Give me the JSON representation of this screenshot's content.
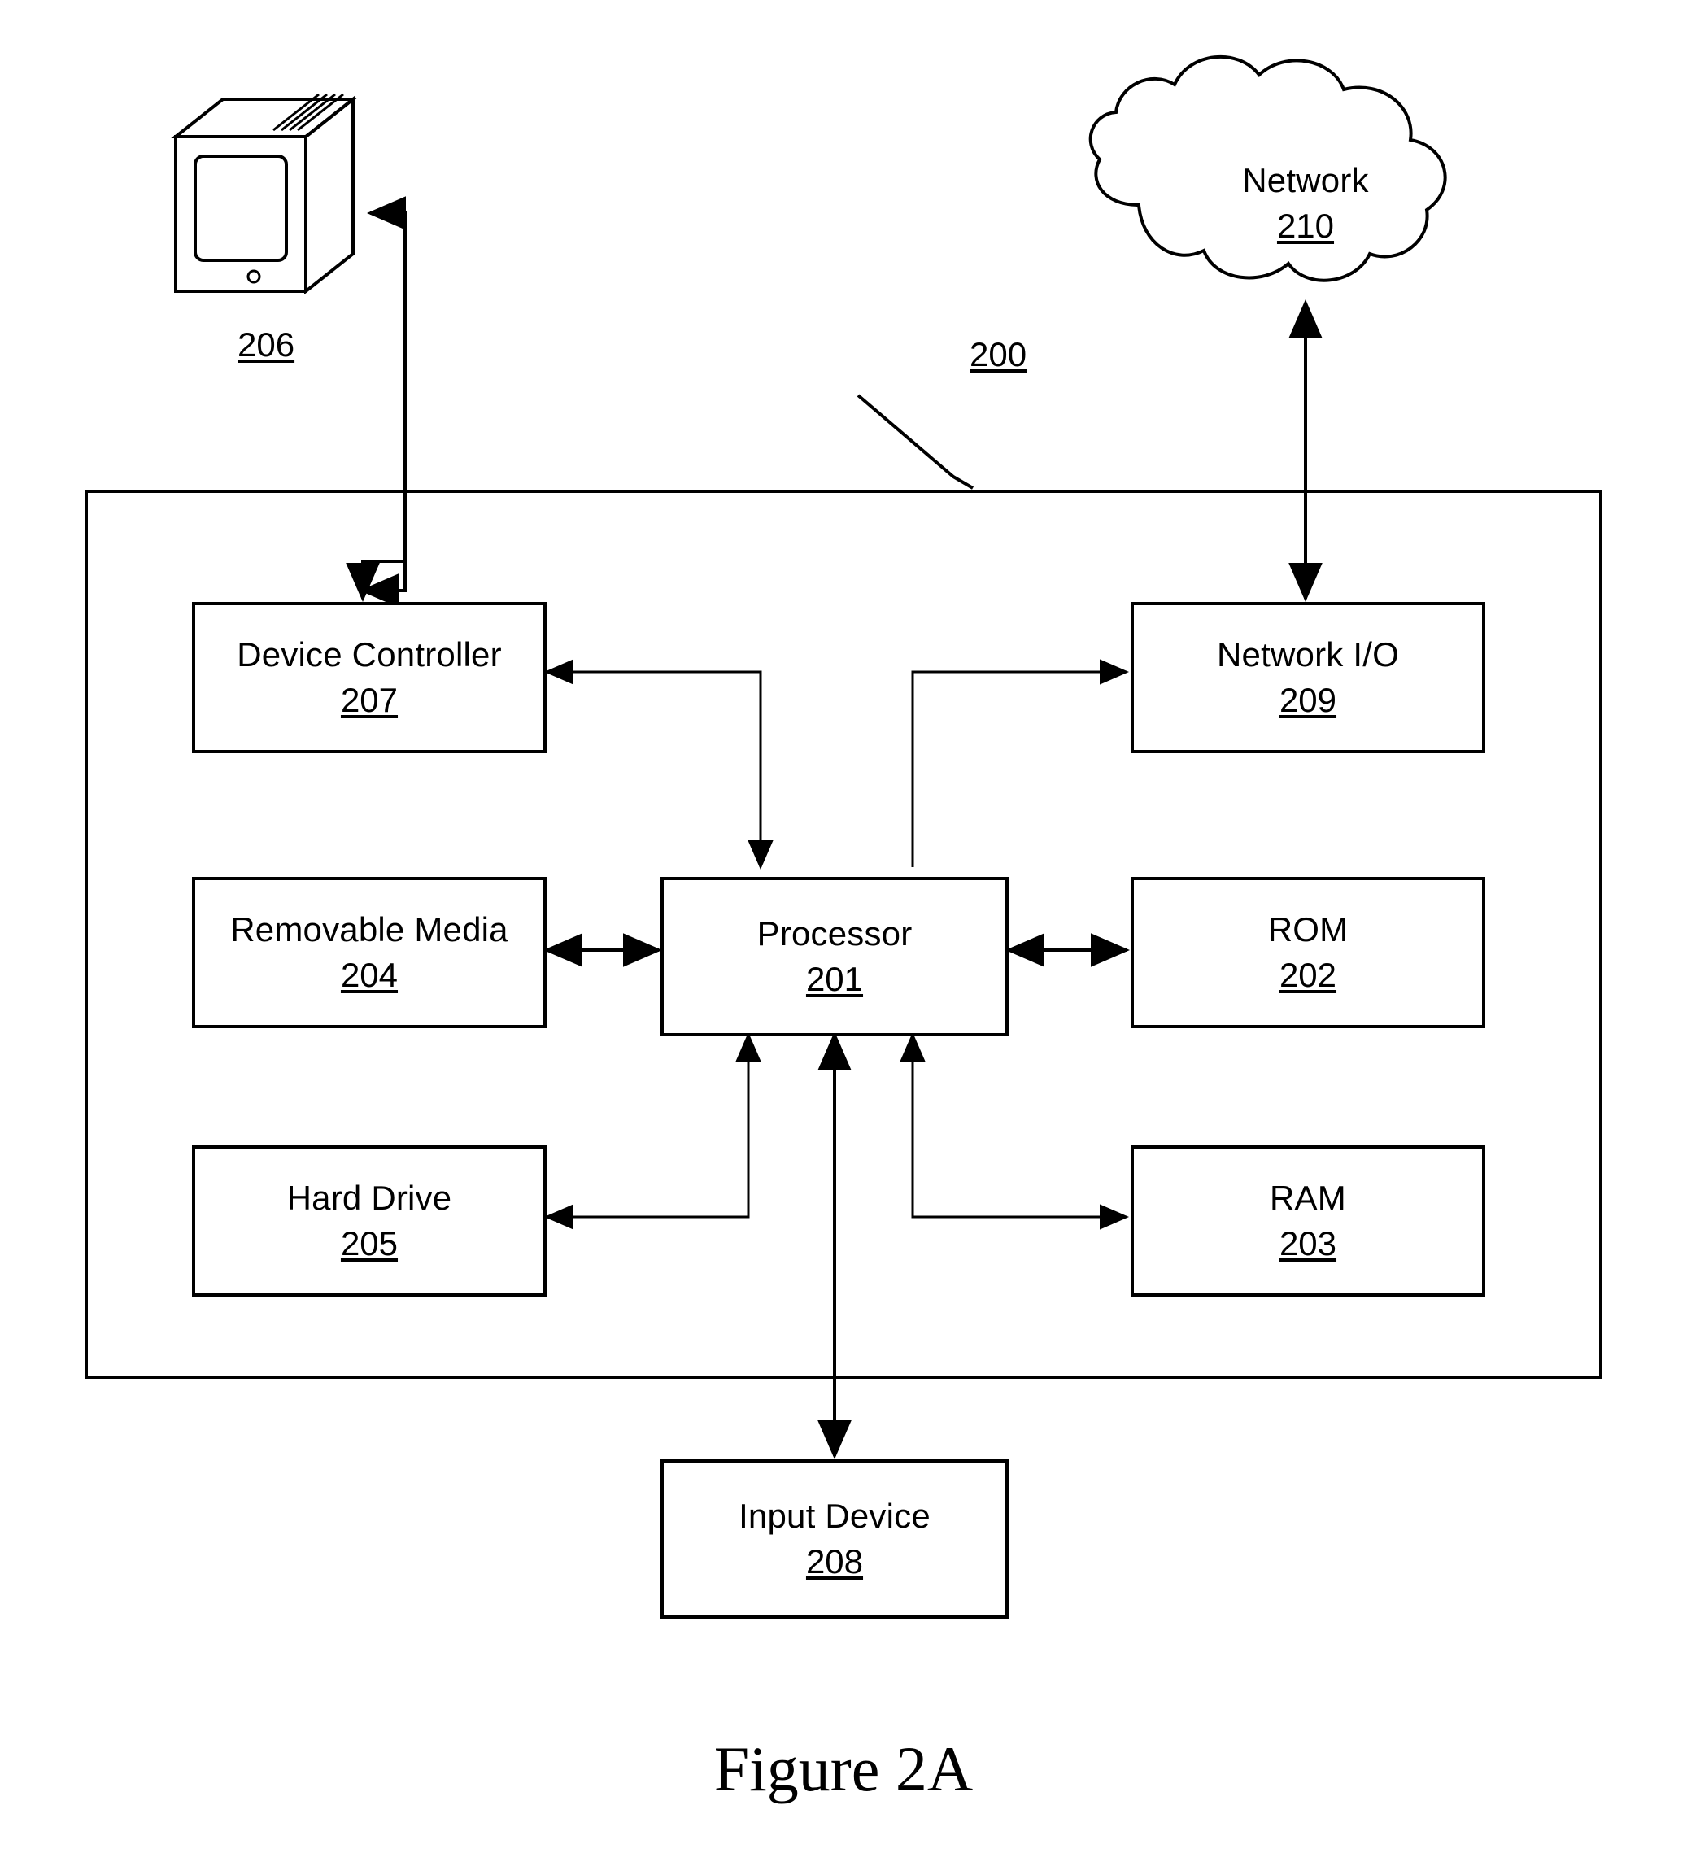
{
  "figure": {
    "caption": "Figure 2A",
    "system_ref": "200"
  },
  "external": {
    "monitor": {
      "name": "monitor-display",
      "ref": "206"
    },
    "network_cloud": {
      "label": "Network",
      "ref": "210"
    }
  },
  "nodes": [
    {
      "key": "device_controller",
      "label": "Device Controller",
      "ref": "207"
    },
    {
      "key": "network_io",
      "label": "Network I/O",
      "ref": "209"
    },
    {
      "key": "removable_media",
      "label": "Removable Media",
      "ref": "204"
    },
    {
      "key": "processor",
      "label": "Processor",
      "ref": "201"
    },
    {
      "key": "rom",
      "label": "ROM",
      "ref": "202"
    },
    {
      "key": "hard_drive",
      "label": "Hard Drive",
      "ref": "205"
    },
    {
      "key": "ram",
      "label": "RAM",
      "ref": "203"
    },
    {
      "key": "input_device",
      "label": "Input Device",
      "ref": "208"
    }
  ],
  "connections": [
    {
      "from": "monitor",
      "to": "device_controller",
      "arrow": "single"
    },
    {
      "from": "network_cloud",
      "to": "network_io",
      "arrow": "double"
    },
    {
      "from": "device_controller",
      "to": "processor",
      "arrow": "single"
    },
    {
      "from": "processor",
      "to": "network_io",
      "arrow": "single"
    },
    {
      "from": "removable_media",
      "to": "processor",
      "arrow": "double"
    },
    {
      "from": "processor",
      "to": "rom",
      "arrow": "double"
    },
    {
      "from": "processor",
      "to": "hard_drive",
      "arrow": "single"
    },
    {
      "from": "processor",
      "to": "ram",
      "arrow": "single"
    },
    {
      "from": "input_device",
      "to": "processor",
      "arrow": "double"
    }
  ],
  "colors": {
    "line": "#000000",
    "background": "#ffffff"
  }
}
